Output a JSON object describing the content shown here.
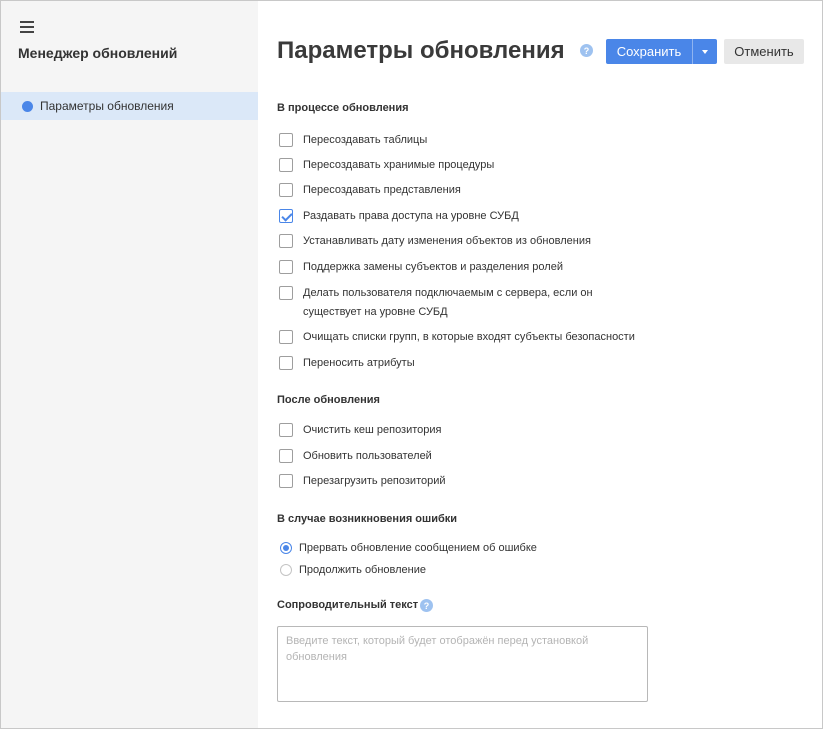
{
  "sidebar": {
    "title": "Менеджер обновлений",
    "items": [
      {
        "label": "Параметры обновления"
      }
    ]
  },
  "header": {
    "title": "Параметры обновления",
    "help_glyph": "?",
    "save_label": "Сохранить",
    "cancel_label": "Отменить"
  },
  "sections": {
    "during": {
      "title": "В процессе обновления",
      "options": [
        {
          "label": "Пересоздавать таблицы",
          "checked": false
        },
        {
          "label": "Пересоздавать хранимые процедуры",
          "checked": false
        },
        {
          "label": "Пересоздавать представления",
          "checked": false
        },
        {
          "label": "Раздавать права доступа на уровне СУБД",
          "checked": true
        },
        {
          "label": "Устанавливать дату изменения объектов из обновления",
          "checked": false
        },
        {
          "label": "Поддержка замены субъектов и разделения ролей",
          "checked": false
        },
        {
          "label": "Делать пользователя подключаемым с сервера, если он существует на уровне СУБД",
          "checked": false
        },
        {
          "label": "Очищать списки групп, в которые входят субъекты безопасности",
          "checked": false
        },
        {
          "label": "Переносить атрибуты",
          "checked": false
        }
      ]
    },
    "after": {
      "title": "После обновления",
      "options": [
        {
          "label": "Очистить кеш репозитория",
          "checked": false
        },
        {
          "label": "Обновить пользователей",
          "checked": false
        },
        {
          "label": "Перезагрузить репозиторий",
          "checked": false
        }
      ]
    },
    "on_error": {
      "title": "В случае возникновения ошибки",
      "options": [
        {
          "label": "Прервать обновление сообщением об ошибке",
          "selected": true
        },
        {
          "label": "Продолжить обновление",
          "selected": false
        }
      ]
    },
    "note": {
      "title": "Сопроводительный текст",
      "help_glyph": "?",
      "value": "",
      "placeholder": "Введите текст, который будет отображён перед установкой обновления"
    }
  },
  "colors": {
    "accent": "#4a86e8",
    "sidebar_bg": "#f5f5f5",
    "selected_nav_bg": "#dbe8f8",
    "help_icon": "#9ec2f0"
  }
}
